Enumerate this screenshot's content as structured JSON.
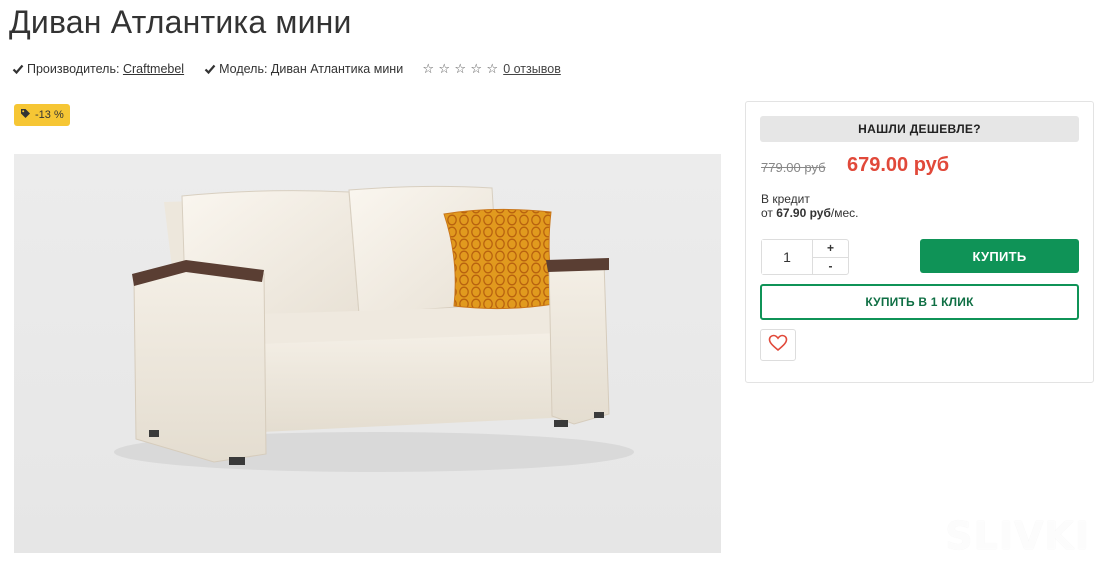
{
  "product": {
    "title": "Диван Атлантика мини",
    "manufacturer_label": "Производитель:",
    "manufacturer_value": "Craftmebel",
    "model_label": "Модель:",
    "model_value": "Диван Атлантика мини",
    "rating_stars": 0,
    "rating_max": 5,
    "reviews_link": "0 отзывов",
    "discount_badge": "-13 %"
  },
  "buy_box": {
    "cheaper_label": "НАШЛИ ДЕШЕВЛЕ?",
    "old_price": "779.00 руб",
    "new_price": "679.00 руб",
    "credit_label": "В кредит",
    "credit_from": "от",
    "credit_amount": "67.90 руб",
    "credit_period": "/мес.",
    "quantity": "1",
    "plus": "+",
    "minus": "-",
    "buy_label": "КУПИТЬ",
    "one_click_label": "КУПИТЬ В 1 КЛИК"
  },
  "icons": {
    "check": "check-icon",
    "star": "star-outline-icon",
    "tag": "tag-icon",
    "wishlist": "heart-outline-icon"
  },
  "colors": {
    "accent_green": "#0f9357",
    "price_red": "#e1493a",
    "badge_yellow": "#f6c634",
    "pillow_orange": "#e19a1e"
  },
  "watermark": "SLIVKI"
}
